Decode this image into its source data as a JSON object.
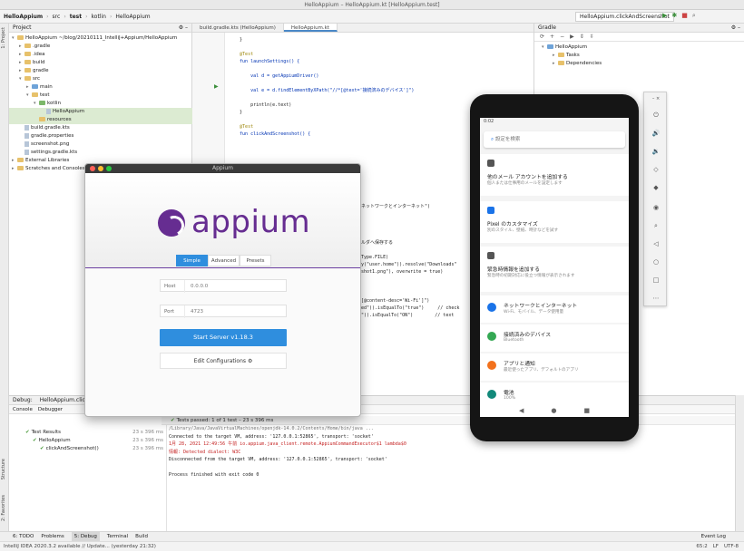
{
  "window": {
    "title": "HelloAppium – HelloAppium.kt [HelloAppium.test]"
  },
  "breadcrumb": [
    "HelloAppium",
    "src",
    "test",
    "kotlin",
    "HelloAppium"
  ],
  "run_config": "HelloAppium.clickAndScreenshot",
  "left_strip": {
    "project": "1: Project",
    "structure": "Structure",
    "favorites": "2: Favorites"
  },
  "project_panel": {
    "title": "Project",
    "rows": [
      {
        "label": "HelloAppium ~/blog/20210111_IntelliJ+Appium/HelloAppium",
        "indent": 0,
        "icon": "folder",
        "arrow": "▾"
      },
      {
        "label": ".gradle",
        "indent": 1,
        "icon": "folder",
        "arrow": "▸"
      },
      {
        "label": ".idea",
        "indent": 1,
        "icon": "folder",
        "arrow": "▸"
      },
      {
        "label": "build",
        "indent": 1,
        "icon": "folder",
        "arrow": "▸"
      },
      {
        "label": "gradle",
        "indent": 1,
        "icon": "folder",
        "arrow": "▸"
      },
      {
        "label": "src",
        "indent": 1,
        "icon": "folder",
        "arrow": "▾"
      },
      {
        "label": "main",
        "indent": 2,
        "icon": "folder-blue",
        "arrow": "▸"
      },
      {
        "label": "test",
        "indent": 2,
        "icon": "folder",
        "arrow": "▾"
      },
      {
        "label": "kotlin",
        "indent": 3,
        "icon": "folder-green",
        "arrow": "▾"
      },
      {
        "label": "HelloAppium",
        "indent": 4,
        "icon": "file",
        "arrow": ""
      },
      {
        "label": "resources",
        "indent": 3,
        "icon": "folder",
        "arrow": ""
      },
      {
        "label": "build.gradle.kts",
        "indent": 1,
        "icon": "file",
        "arrow": ""
      },
      {
        "label": "gradle.properties",
        "indent": 1,
        "icon": "file",
        "arrow": ""
      },
      {
        "label": "screenshot.png",
        "indent": 1,
        "icon": "file",
        "arrow": ""
      },
      {
        "label": "settings.gradle.kts",
        "indent": 1,
        "icon": "file",
        "arrow": ""
      },
      {
        "label": "External Libraries",
        "indent": 0,
        "icon": "folder",
        "arrow": "▸"
      },
      {
        "label": "Scratches and Consoles",
        "indent": 0,
        "icon": "folder",
        "arrow": "▸"
      }
    ]
  },
  "editor": {
    "tabs": [
      {
        "label": "build.gradle.kts (HelloAppium)",
        "active": false
      },
      {
        "label": "HelloAppium.kt",
        "active": true
      }
    ],
    "lines": [
      "    }",
      "",
      "    @Test",
      "    fun launchSettings() {",
      "",
      "        val d = getAppiumDriver()",
      "",
      "        val e = d.findElementByXPath(\"//*[@text='接続済みのデバイス']\")",
      "",
      "        println(e.text)",
      "    }",
      "",
      "    @Test",
      "    fun clickAndScreenshot() {"
    ],
    "lines_right": [
      "ネットワークとインターネット\")",
      "",
      "",
      "",
      "",
      "ルダへ保存する",
      "",
      "Type.FILE)",
      "y(\"user.home\")).resolve(\"Downloads\"",
      "shot1.png\"), overwrite = true)",
      "",
      "",
      "",
      "[@content-desc='Wi-Fi']\")",
      "ed\")).isEqualTo(\"true\")     // check",
      "\")).isEqualTo(\"ON\")        // text"
    ]
  },
  "gradle_panel": {
    "title": "Gradle",
    "root": "HelloAppium",
    "children": [
      "Tasks",
      "Dependencies"
    ]
  },
  "appium": {
    "title": "Appium",
    "logo_text": "appium",
    "tabs": [
      "Simple",
      "Advanced",
      "Presets"
    ],
    "host_label": "Host",
    "host_value": "0.0.0.0",
    "port_label": "Port",
    "port_value": "4723",
    "start_label": "Start Server v1.18.3",
    "edit_label": "Edit Configurations"
  },
  "phone": {
    "time": "0:02",
    "search_placeholder": "設定を検索",
    "items": [
      {
        "title": "他のメール アカウントを追加する",
        "subtitle": "個人または仕事用のメールを設定します",
        "icon_color": "#555555"
      },
      {
        "title": "Pixel のカスタマイズ",
        "subtitle": "別のスタイル、壁紙、時計などを試す",
        "icon_color": "#1a73e8"
      },
      {
        "title": "緊急時情報を追加する",
        "subtitle": "緊急時の初期対応に役立つ情報が表示されます",
        "icon_color": "#555555"
      },
      {
        "title": "ネットワークとインターネット",
        "subtitle": "Wi-Fi、モバイル、データ使用量",
        "icon_color": "#1a73e8"
      },
      {
        "title": "接続済みのデバイス",
        "subtitle": "Bluetooth",
        "icon_color": "#34a853"
      },
      {
        "title": "アプリと通知",
        "subtitle": "最近使ったアプリ、デフォルトのアプリ",
        "icon_color": "#f2711c"
      },
      {
        "title": "電池",
        "subtitle": "100%",
        "icon_color": "#12897a"
      }
    ]
  },
  "debug": {
    "title": "Debug:",
    "config_tab": "HelloAppium.click",
    "console_tab": "Console",
    "debugger_tab": "Debugger",
    "pass_text": "Tests passed: 1 of 1 test – 23 s 396 ms",
    "tests": [
      {
        "label": "Test Results",
        "time": "23 s 396 ms",
        "indent": 0
      },
      {
        "label": "HelloAppium",
        "time": "23 s 396 ms",
        "indent": 1
      },
      {
        "label": "clickAndScreenshot()",
        "time": "23 s 396 ms",
        "indent": 2
      }
    ],
    "console": [
      {
        "text": "/Library/Java/JavaVirtualMachines/openjdk-14.0.2/Contents/Home/bin/java ...",
        "cls": "grey"
      },
      {
        "text": "Connected to the target VM, address: '127.0.0.1:52865', transport: 'socket'",
        "cls": ""
      },
      {
        "text": "1月 28, 2021 12:49:56 午前 io.appium.java_client.remote.AppiumCommandExecutor$1 lambda$0",
        "cls": "red"
      },
      {
        "text": "情報: Detected dialect: W3C",
        "cls": "red"
      },
      {
        "text": "Disconnected from the target VM, address: '127.0.0.1:52865', transport: 'socket'",
        "cls": ""
      },
      {
        "text": "",
        "cls": ""
      },
      {
        "text": "Process finished with exit code 0",
        "cls": ""
      }
    ]
  },
  "bottom_tabs": [
    "6: TODO",
    "Problems",
    "5: Debug",
    "Terminal",
    "Build"
  ],
  "event_log": "Event Log",
  "status": {
    "left": "IntelliJ IDEA 2020.3.2 available // Update... (yesterday 21:32)",
    "pos": "65:2",
    "lf": "LF",
    "enc": "UTF-8"
  }
}
